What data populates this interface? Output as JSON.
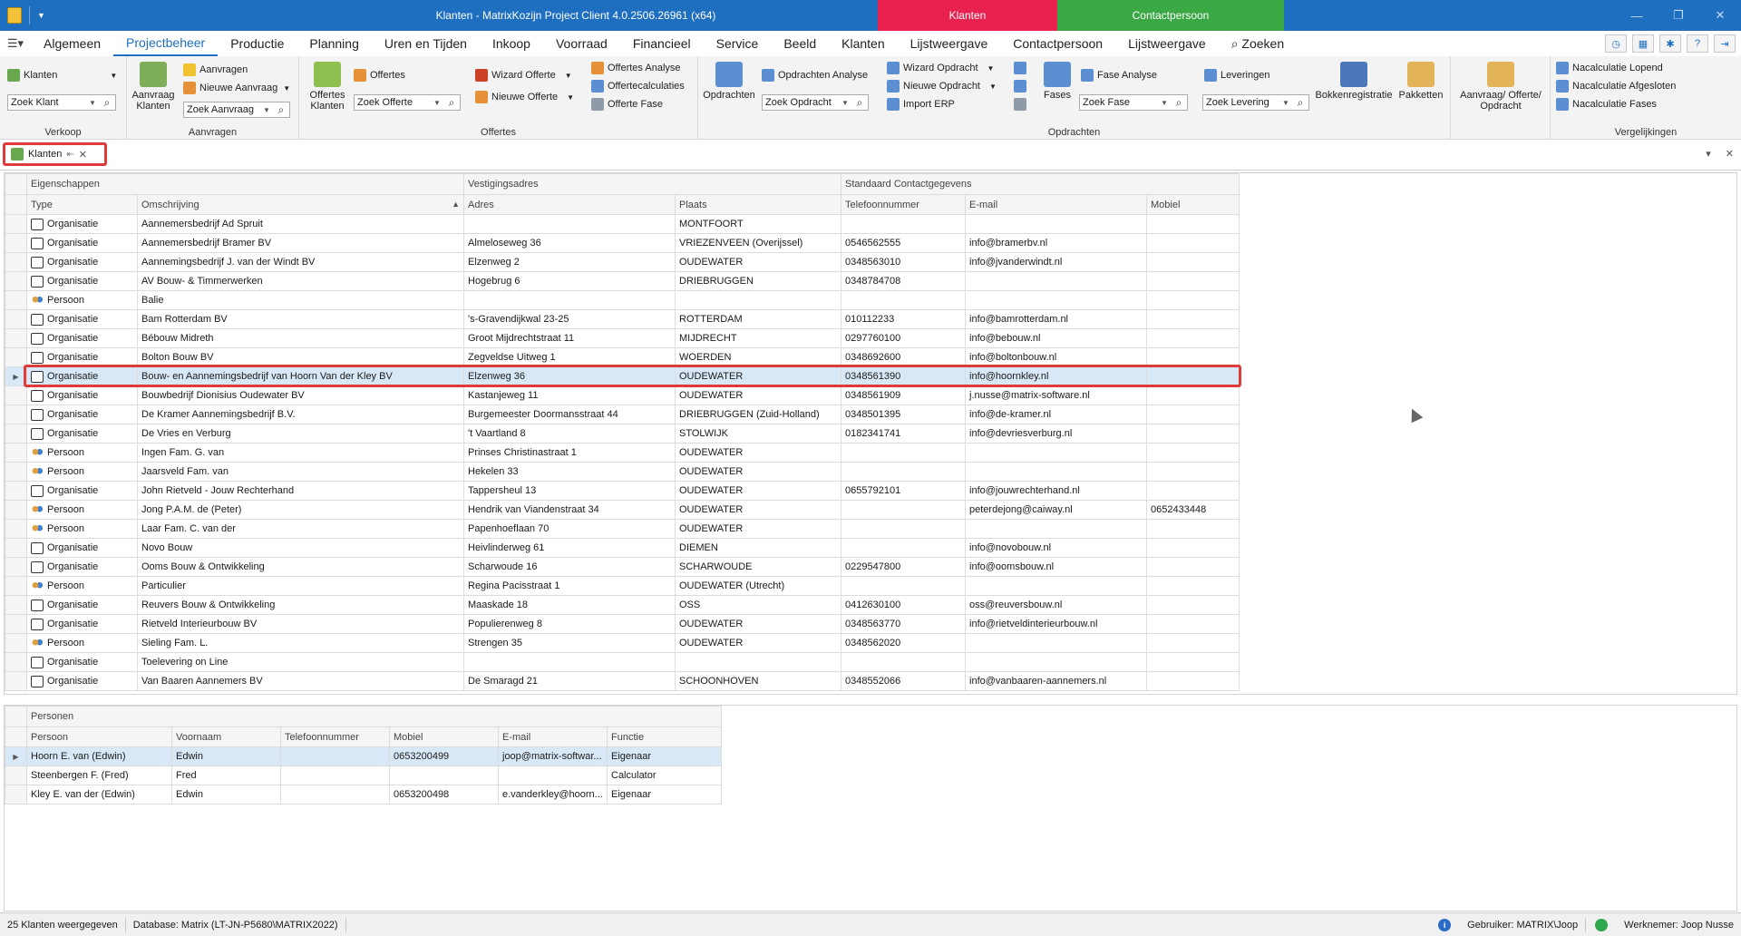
{
  "titlebar": {
    "title": "Klanten - MatrixKozijn Project Client 4.0.2506.26961 (x64)",
    "context_tab_klanten": "Klanten",
    "context_tab_contactpersoon": "Contactpersoon",
    "colors": {
      "titlebar": "#1e6fbf",
      "klanten": "#e8214f",
      "contactpersoon": "#3aa845"
    }
  },
  "menu": {
    "items": [
      "Algemeen",
      "Projectbeheer",
      "Productie",
      "Planning",
      "Uren en Tijden",
      "Inkoop",
      "Voorraad",
      "Financieel",
      "Service",
      "Beeld",
      "Klanten",
      "Lijstweergave",
      "Contactpersoon",
      "Lijstweergave",
      "⌕ Zoeken"
    ],
    "active": "Projectbeheer"
  },
  "ribbon": {
    "verkoop": {
      "label": "Verkoop",
      "klanten": "Klanten",
      "zoek": "Zoek Klant"
    },
    "aanvragen": {
      "label": "Aanvragen",
      "big": "Aanvraag Klanten",
      "aanvragen": "Aanvragen",
      "nieuwe": "Nieuwe Aanvraag",
      "zoek": "Zoek Aanvraag"
    },
    "offertes": {
      "label": "Offertes",
      "big": "Offertes Klanten",
      "offertes": "Offertes",
      "zoek": "Zoek Offerte",
      "wizard": "Wizard Offerte",
      "nieuwe": "Nieuwe Offerte",
      "analyse": "Offertes Analyse",
      "calc": "Offertecalculaties",
      "fase": "Offerte Fase"
    },
    "opdrachten": {
      "label": "Opdrachten",
      "big": "Opdrachten",
      "analyse": "Opdrachten Analyse",
      "zoek": "Zoek Opdracht",
      "wizard": "Wizard Opdracht",
      "nieuwe": "Nieuwe Opdracht",
      "import": "Import ERP",
      "fases": "Fases",
      "fase_analyse": "Fase Analyse",
      "zoek_fase": "Zoek Fase"
    },
    "leveringen": {
      "leveringen": "Leveringen",
      "zoek": "Zoek Levering",
      "bokken": "Bokkenregistratie",
      "pakketten": "Pakketten"
    },
    "aanvraag_opdracht": "Aanvraag/ Offerte/ Opdracht",
    "vergelijkingen": {
      "label": "Vergelijkingen",
      "lopend": "Nacalculatie Lopend",
      "afgesloten": "Nacalculatie Afgesloten",
      "fases": "Nacalculatie Fases"
    }
  },
  "doctab": {
    "label": "Klanten"
  },
  "grid": {
    "bands": [
      "Eigenschappen",
      "Vestigingsadres",
      "Standaard Contactgegevens"
    ],
    "columns": [
      "Type",
      "Omschrijving",
      "Adres",
      "Plaats",
      "Telefoonnummer",
      "E-mail",
      "Mobiel"
    ],
    "selected_index": 8,
    "rows": [
      [
        "Organisatie",
        "Aannemersbedrijf Ad Spruit",
        "",
        "MONTFOORT",
        "",
        "",
        ""
      ],
      [
        "Organisatie",
        "Aannemersbedrijf Bramer BV",
        "Almeloseweg 36",
        "VRIEZENVEEN (Overijssel)",
        "0546562555",
        "info@bramerbv.nl",
        ""
      ],
      [
        "Organisatie",
        "Aannemingsbedrijf J. van der Windt BV",
        "Elzenweg 2",
        "OUDEWATER",
        "0348563010",
        "info@jvanderwindt.nl",
        ""
      ],
      [
        "Organisatie",
        "AV Bouw- & Timmerwerken",
        "Hogebrug 6",
        "DRIEBRUGGEN",
        "0348784708",
        "",
        ""
      ],
      [
        "Persoon",
        "Balie",
        "",
        "",
        "",
        "",
        ""
      ],
      [
        "Organisatie",
        "Bam Rotterdam BV",
        "'s-Gravendijkwal 23-25",
        "ROTTERDAM",
        "010112233",
        "info@bamrotterdam.nl",
        ""
      ],
      [
        "Organisatie",
        "Bébouw Midreth",
        "Groot Mijdrechtstraat 11",
        "MIJDRECHT",
        "0297760100",
        "info@bebouw.nl",
        ""
      ],
      [
        "Organisatie",
        "Bolton Bouw BV",
        "Zegveldse Uitweg 1",
        "WOERDEN",
        "0348692600",
        "info@boltonbouw.nl",
        ""
      ],
      [
        "Organisatie",
        "Bouw- en Aannemingsbedrijf van Hoorn Van der Kley BV",
        "Elzenweg 36",
        "OUDEWATER",
        "0348561390",
        "info@hoornkley.nl",
        ""
      ],
      [
        "Organisatie",
        "Bouwbedrijf Dionisius Oudewater BV",
        "Kastanjeweg 11",
        "OUDEWATER",
        "0348561909",
        "j.nusse@matrix-software.nl",
        ""
      ],
      [
        "Organisatie",
        "De Kramer Aannemingsbedrijf B.V.",
        "Burgemeester Doormansstraat 44",
        "DRIEBRUGGEN (Zuid-Holland)",
        "0348501395",
        "info@de-kramer.nl",
        ""
      ],
      [
        "Organisatie",
        "De Vries en Verburg",
        "'t Vaartland 8",
        "STOLWIJK",
        "0182341741",
        "info@devriesverburg.nl",
        ""
      ],
      [
        "Persoon",
        "Ingen Fam. G. van",
        "Prinses Christinastraat 1",
        "OUDEWATER",
        "",
        "",
        ""
      ],
      [
        "Persoon",
        "Jaarsveld Fam. van",
        "Hekelen 33",
        "OUDEWATER",
        "",
        "",
        ""
      ],
      [
        "Organisatie",
        "John Rietveld - Jouw Rechterhand",
        "Tappersheul 13",
        "OUDEWATER",
        "0655792101",
        "info@jouwrechterhand.nl",
        ""
      ],
      [
        "Persoon",
        "Jong P.A.M. de (Peter)",
        "Hendrik van Viandenstraat 34",
        "OUDEWATER",
        "",
        "peterdejong@caiway.nl",
        "0652433448"
      ],
      [
        "Persoon",
        "Laar Fam. C. van der",
        "Papenhoeflaan 70",
        "OUDEWATER",
        "",
        "",
        ""
      ],
      [
        "Organisatie",
        "Novo Bouw",
        "Heivlinderweg 61",
        "DIEMEN",
        "",
        "info@novobouw.nl",
        ""
      ],
      [
        "Organisatie",
        "Ooms Bouw & Ontwikkeling",
        "Scharwoude 16",
        "SCHARWOUDE",
        "0229547800",
        "info@oomsbouw.nl",
        ""
      ],
      [
        "Persoon",
        "Particulier",
        "Regina Pacisstraat 1",
        "OUDEWATER (Utrecht)",
        "",
        "",
        ""
      ],
      [
        "Organisatie",
        "Reuvers Bouw & Ontwikkeling",
        "Maaskade 18",
        "OSS",
        "0412630100",
        "oss@reuversbouw.nl",
        ""
      ],
      [
        "Organisatie",
        "Rietveld Interieurbouw BV",
        "Populierenweg 8",
        "OUDEWATER",
        "0348563770",
        "info@rietveldinterieurbouw.nl",
        ""
      ],
      [
        "Persoon",
        "Sieling Fam. L.",
        "Strengen 35",
        "OUDEWATER",
        "0348562020",
        "",
        ""
      ],
      [
        "Organisatie",
        "Toelevering on Line",
        "",
        "",
        "",
        "",
        ""
      ],
      [
        "Organisatie",
        "Van Baaren Aannemers BV",
        "De Smaragd 21",
        "SCHOONHOVEN",
        "0348552066",
        "info@vanbaaren-aannemers.nl",
        ""
      ]
    ]
  },
  "personen": {
    "band": "Personen",
    "columns": [
      "Persoon",
      "Voornaam",
      "Telefoonnummer",
      "Mobiel",
      "E-mail",
      "Functie"
    ],
    "rows": [
      [
        "Hoorn E. van (Edwin)",
        "Edwin",
        "",
        "0653200499",
        "joop@matrix-softwar...",
        "Eigenaar"
      ],
      [
        "Steenbergen F. (Fred)",
        "Fred",
        "",
        "",
        "",
        "Calculator"
      ],
      [
        "Kley E. van der (Edwin)",
        "Edwin",
        "",
        "0653200498",
        "e.vanderkley@hoorn...",
        "Eigenaar"
      ]
    ]
  },
  "status": {
    "count": "25 Klanten weergegeven",
    "database": "Database: Matrix (LT-JN-P5680\\MATRIX2022)",
    "user": "Gebruiker: MATRIX\\Joop",
    "employee": "Werknemer: Joop Nusse"
  }
}
